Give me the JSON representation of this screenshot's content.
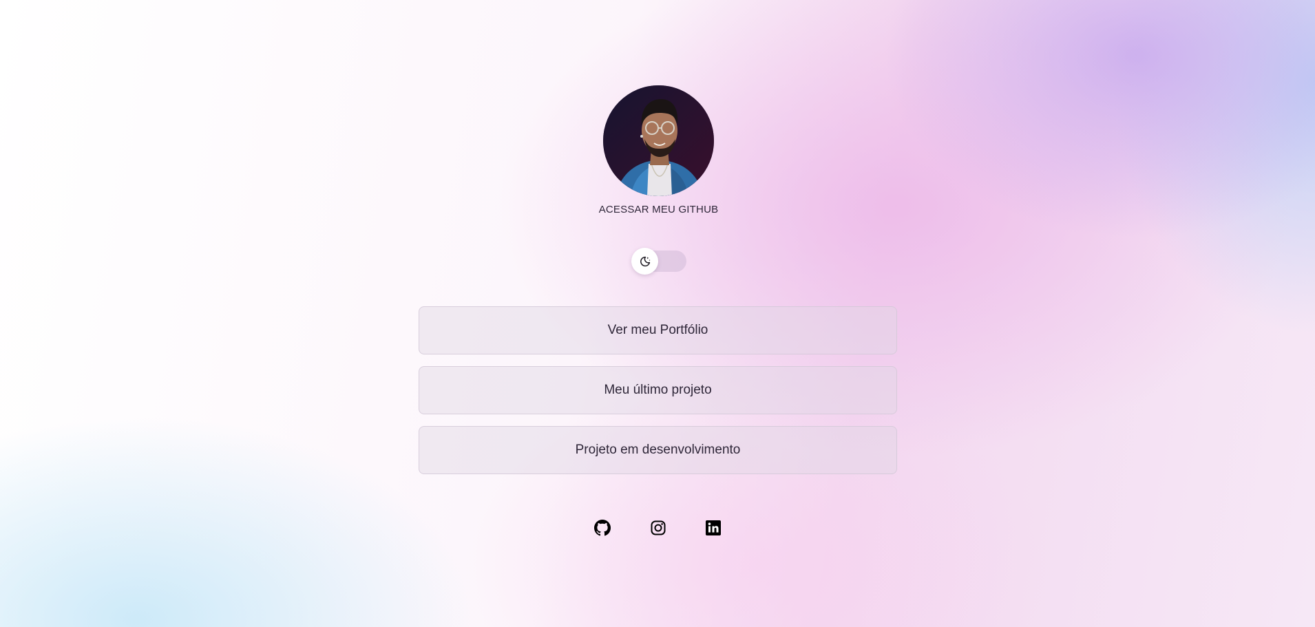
{
  "profile": {
    "github_link_label": "ACESSAR MEU GITHUB"
  },
  "theme_toggle": {
    "icon": "moon-stars-icon",
    "state": "off"
  },
  "links": [
    {
      "label": "Ver meu Portfólio"
    },
    {
      "label": "Meu último projeto"
    },
    {
      "label": "Projeto em desenvolvimento"
    }
  ],
  "socials": [
    {
      "icon": "github-icon"
    },
    {
      "icon": "instagram-icon"
    },
    {
      "icon": "linkedin-icon"
    }
  ],
  "colors": {
    "text": "#2e2638",
    "button_bg": "#e1d7e4",
    "accent_pink": "#ecb4e8",
    "accent_lilac": "#c8aaee",
    "accent_blue": "#b9cdf5"
  }
}
